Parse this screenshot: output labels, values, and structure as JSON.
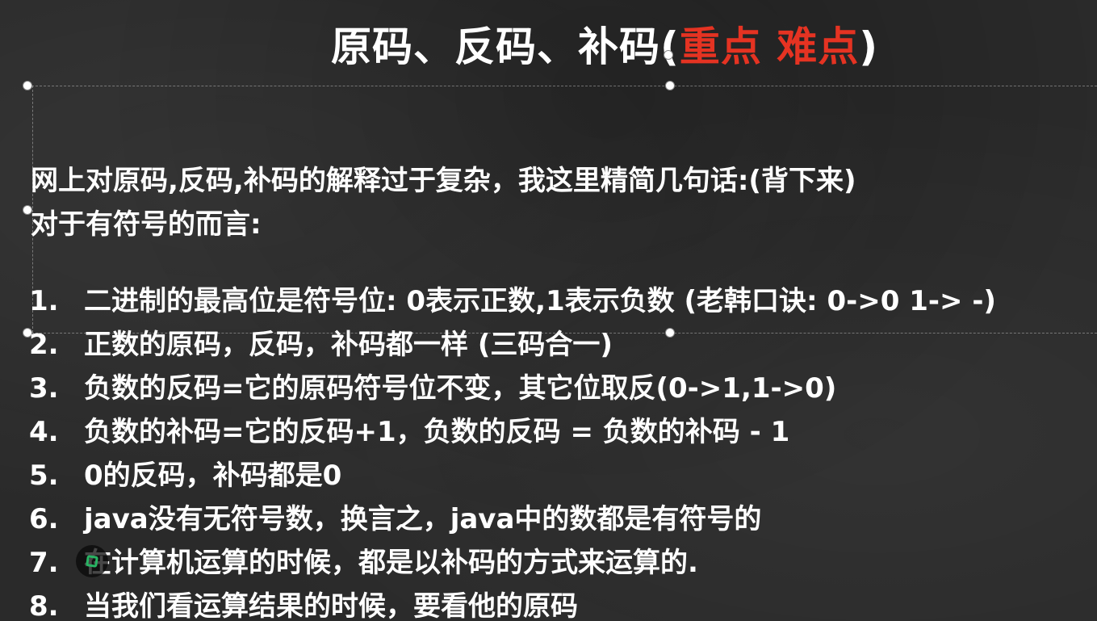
{
  "slide": {
    "title": "原码、反码、补码(",
    "title_accent": "重点 难点",
    "title_close": ")",
    "intro": "网上对原码,反码,补码的解释过于复杂，我这里精简几句话:(背下来)",
    "subtitle": "对于有符号的而言:",
    "items": [
      {
        "num": "1.",
        "text": "二进制的最高位是符号位: 0表示正数,1表示负数 (老韩口诀: 0->0 1-> -)"
      },
      {
        "num": "2.",
        "text": "正数的原码，反码，补码都一样 (三码合一)"
      },
      {
        "num": "3.",
        "text": "负数的反码=它的原码符号位不变，其它位取反(0->1,1->0)"
      },
      {
        "num": "4.",
        "text": "负数的补码=它的反码+1，负数的反码 =  负数的补码 - 1"
      },
      {
        "num": "5.",
        "text": "0的反码，补码都是0"
      },
      {
        "num": "6.",
        "text": "java没有无符号数，换言之，java中的数都是有符号的"
      },
      {
        "num": "7.",
        "text": "在计算机运算的时候，都是以补码的方式来运算的."
      },
      {
        "num": "8.",
        "text": "当我们看运算结果的时候，要看他的原码"
      }
    ]
  },
  "colors": {
    "background": "#2a2a2a",
    "text": "#ffffff",
    "accent": "#e53322",
    "cursor": "#28b463"
  },
  "icons": {
    "cursor": "cursor-highlight-icon"
  }
}
